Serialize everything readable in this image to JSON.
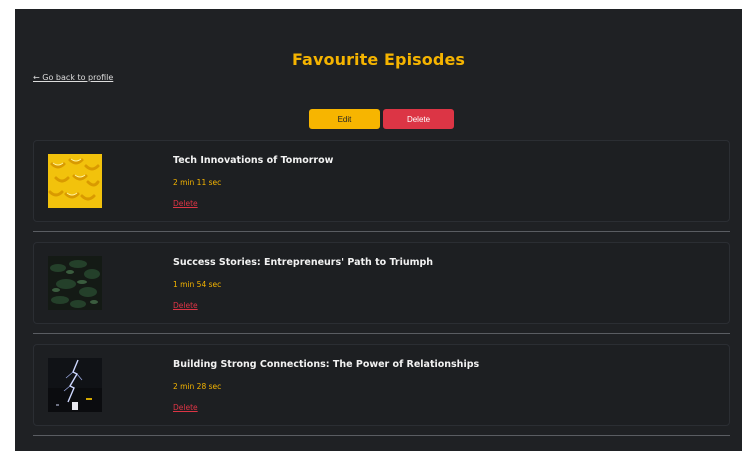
{
  "page": {
    "title": "Favourite Episodes",
    "back_link": "← Go back to profile"
  },
  "actions": {
    "edit_label": "Edit",
    "delete_label": "Delete"
  },
  "episodes": [
    {
      "title": "Tech Innovations of Tomorrow",
      "duration": "2 min 11 sec",
      "delete_label": "Delete",
      "thumbnail": "yellow-bananas-image"
    },
    {
      "title": "Success Stories: Entrepreneurs' Path to Triumph",
      "duration": "1 min 54 sec",
      "delete_label": "Delete",
      "thumbnail": "dark-foliage-image"
    },
    {
      "title": "Building Strong Connections: The Power of Relationships",
      "duration": "2 min 28 sec",
      "delete_label": "Delete",
      "thumbnail": "lightning-night-image"
    }
  ],
  "colors": {
    "background": "#1f2124",
    "accent": "#f5b400",
    "danger": "#dc3545",
    "text": "#f2f2f2"
  }
}
